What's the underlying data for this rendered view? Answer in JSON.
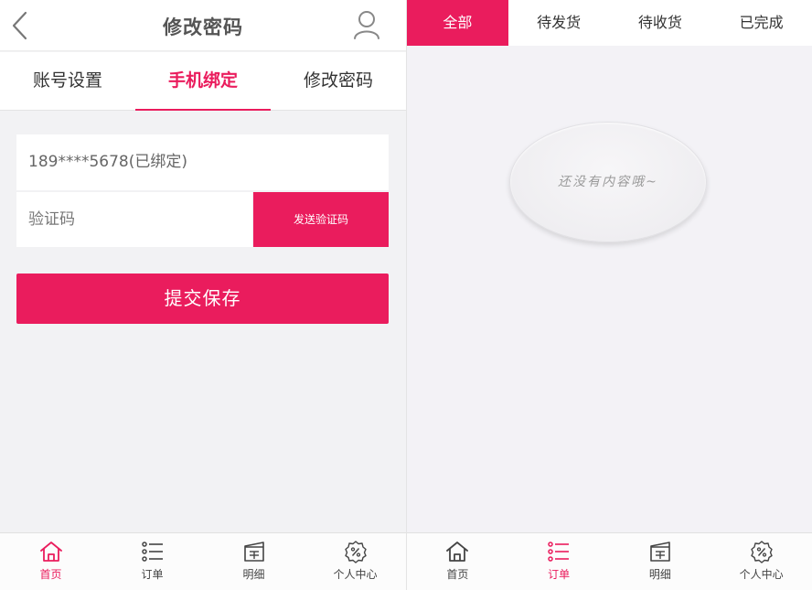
{
  "account": {
    "header": {
      "title": "修改密码"
    },
    "tabs": [
      {
        "label": "账号设置"
      },
      {
        "label": "手机绑定"
      },
      {
        "label": "修改密码"
      }
    ],
    "form": {
      "phone_value": "189****5678(已绑定)",
      "code_placeholder": "验证码",
      "send_code_label": "发送验证码",
      "submit_label": "提交保存"
    },
    "active_tab": "手机绑定"
  },
  "orders": {
    "tabs": [
      {
        "label": "全部"
      },
      {
        "label": "待发货"
      },
      {
        "label": "待收货"
      },
      {
        "label": "已完成"
      }
    ],
    "active_tab": "全部",
    "empty_message": "还没有内容哦~"
  },
  "nav": {
    "items": [
      {
        "label": "首页",
        "icon": "home-icon"
      },
      {
        "label": "订单",
        "icon": "list-icon"
      },
      {
        "label": "明细",
        "icon": "detail-icon"
      },
      {
        "label": "个人中心",
        "icon": "settings-icon"
      }
    ]
  },
  "colors": {
    "accent": "#ea1c5d",
    "background": "#f2f2f4"
  }
}
